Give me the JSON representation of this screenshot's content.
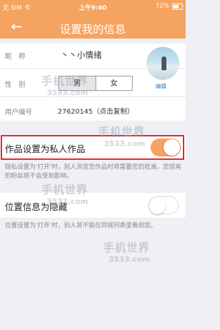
{
  "status_bar": {
    "carrier": "无 SIM 卡",
    "time": "上午9:40",
    "battery": "72%"
  },
  "nav": {
    "back_icon": "←",
    "title": "设置我的信息"
  },
  "profile": {
    "nickname_label": "昵　称",
    "nickname_value": "丶丶小情绪",
    "gender_label": "性　别",
    "gender_options": [
      "男",
      "女"
    ],
    "uid_label": "用户编号",
    "uid_value": "27620145（点击复制）",
    "edit_label": "编辑"
  },
  "private_works": {
    "label": "作品设置为私人作品",
    "enabled": true,
    "description": "隐私设置为'打开'时，别人浏览您作品时将需要您的批准。您现有的粉丝将不会受到影响。"
  },
  "hide_location": {
    "label": "位置信息为隐藏",
    "enabled": false,
    "description": "位置设置为'打开'时，别人将不能在同城列表里看到您。"
  },
  "watermark": {
    "brand": "手机世界",
    "number": "3533.com"
  }
}
